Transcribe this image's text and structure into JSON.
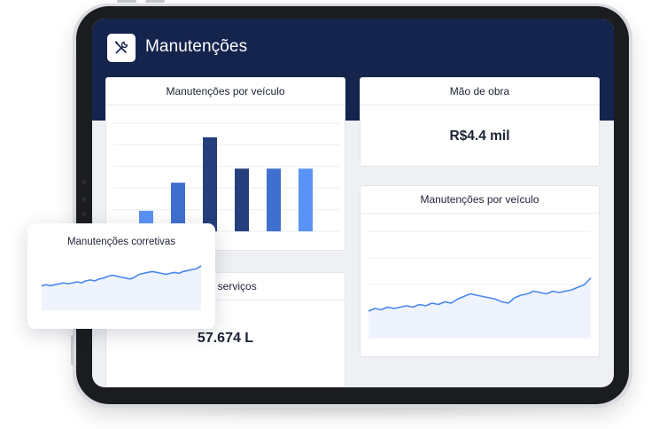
{
  "app": {
    "title": "Manutenções",
    "logo_icon": "wrench-screwdriver-icon"
  },
  "cards": {
    "vehicle_bar": {
      "title": "Manutenções por veículo"
    },
    "labor": {
      "title": "Mão de obra",
      "value": "R$4.4 mil"
    },
    "services": {
      "title": "de serviços",
      "value": "57.674 L"
    },
    "vehicle_line": {
      "title": "Manutenções por veículo"
    },
    "corrective": {
      "title": "Manutenções corretivas"
    }
  },
  "colors": {
    "header": "#15244d",
    "bar_light": "#5a93f5",
    "bar_mid": "#3f6fcf",
    "bar_dark": "#243f7c",
    "line": "#4a86ef",
    "area": "#eef3fd"
  },
  "chart_data": [
    {
      "type": "bar",
      "title": "Manutenções por veículo",
      "categories": [
        "",
        "",
        "",
        "",
        "",
        ""
      ],
      "values": [
        19,
        45,
        87,
        58,
        58,
        58
      ],
      "colors": [
        "#5a93f5",
        "#3f6fcf",
        "#243f7c",
        "#243f7c",
        "#3f6fcf",
        "#5a93f5"
      ],
      "ylim": [
        0,
        100
      ],
      "grid": true
    },
    {
      "type": "area",
      "title": "Manutenções por veículo",
      "values": [
        20,
        22,
        21,
        23,
        22,
        23,
        24,
        23,
        25,
        24,
        26,
        25,
        27,
        26,
        29,
        31,
        33,
        32,
        31,
        30,
        29,
        27,
        26,
        30,
        32,
        33,
        35,
        34,
        33,
        35,
        34,
        35,
        36,
        38,
        40,
        45
      ],
      "ylim": [
        0,
        80
      ],
      "grid": true
    },
    {
      "type": "area",
      "title": "Manutenções corretivas",
      "values": [
        26,
        27,
        26,
        27,
        28,
        29,
        28,
        29,
        30,
        29,
        31,
        32,
        31,
        33,
        34,
        36,
        37,
        36,
        35,
        34,
        33,
        35,
        38,
        39,
        40,
        41,
        40,
        39,
        38,
        39,
        40,
        39,
        41,
        42,
        43,
        44,
        47
      ],
      "ylim": [
        0,
        60
      ],
      "grid": false
    }
  ]
}
